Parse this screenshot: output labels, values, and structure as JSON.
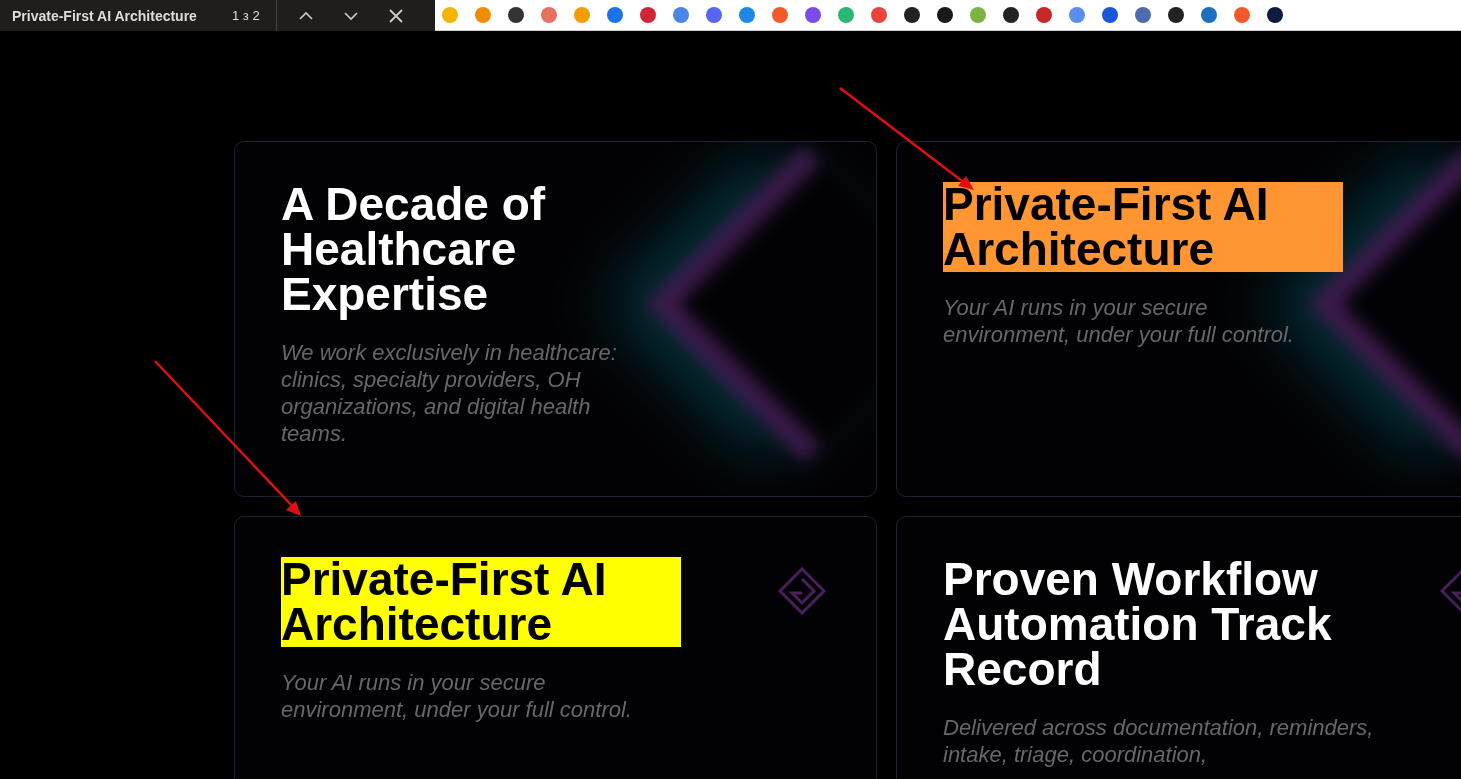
{
  "find_bar": {
    "query": "Private-First AI Architecture",
    "count": "1 з 2"
  },
  "cards": [
    {
      "title": "A Decade of Healthcare Expertise",
      "description": "We work exclusively in healthcare: clinics, specialty providers, OH organizations, and digital health teams.",
      "find_match": false,
      "glow": true,
      "emblem": false
    },
    {
      "title": "Private-First AI Architecture",
      "description": "Your AI runs in your secure environment, under your full control.",
      "find_match": true,
      "current_match": true,
      "glow": true,
      "emblem": false
    },
    {
      "title": "Private-First AI Architecture",
      "description": "Your AI runs in your secure environment, under your full control.",
      "find_match": true,
      "current_match": false,
      "glow": false,
      "emblem": true
    },
    {
      "title": "Proven Workflow Automation Track Record",
      "description": "Delivered across documentation, reminders, intake, triage, coordination,",
      "find_match": false,
      "glow": false,
      "emblem": true
    }
  ]
}
